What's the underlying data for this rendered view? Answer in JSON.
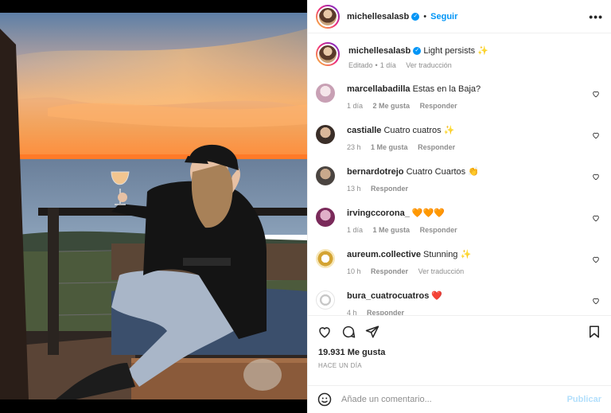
{
  "post": {
    "username": "michellesalasb",
    "follow_label": "Seguir",
    "dot": "•",
    "caption": "Light persists",
    "caption_emoji": "✨",
    "edited_label": "Editado",
    "edited_time": "1 día",
    "translate_label": "Ver traducción",
    "likes_label": "19.931 Me gusta",
    "time_ago": "HACE UN DÍA"
  },
  "comments": [
    {
      "user": "marcellabadilla",
      "text": "Estas en la Baja?",
      "time": "1 día",
      "likes": "2 Me gusta",
      "reply": "Responder",
      "translate": ""
    },
    {
      "user": "castialle",
      "text": "Cuatro cuatros ✨",
      "time": "23 h",
      "likes": "1 Me gusta",
      "reply": "Responder",
      "translate": ""
    },
    {
      "user": "bernardotrejo",
      "text": "Cuatro Cuartos 👏",
      "time": "13 h",
      "likes": "",
      "reply": "Responder",
      "translate": ""
    },
    {
      "user": "irvingccorona_",
      "text": "🧡🧡🧡",
      "time": "1 día",
      "likes": "1 Me gusta",
      "reply": "Responder",
      "translate": ""
    },
    {
      "user": "aureum.collective",
      "text": "Stunning ✨",
      "time": "10 h",
      "likes": "",
      "reply": "Responder",
      "translate": "Ver traducción"
    },
    {
      "user": "bura_cuatrocuatros",
      "text": "❤️",
      "time": "4 h",
      "likes": "",
      "reply": "Responder",
      "translate": ""
    }
  ],
  "composer": {
    "placeholder": "Añade un comentario...",
    "publish_label": "Publicar"
  },
  "colors": {
    "accent": "#0095f6",
    "verified": "#0095f6",
    "publish_disabled": "#b2dffc",
    "meta": "#8e8e8e"
  },
  "icons": [
    "ellipsis-icon",
    "verified-badge-icon",
    "heart-icon",
    "comment-icon",
    "share-icon",
    "bookmark-icon",
    "emoji-icon"
  ]
}
